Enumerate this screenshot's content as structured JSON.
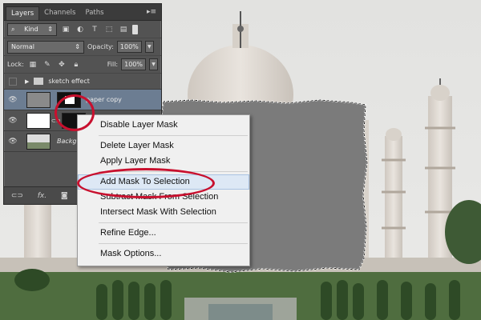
{
  "layers_panel": {
    "tabs": [
      "Layers",
      "Channels",
      "Paths"
    ],
    "filter_kind": "Kind",
    "blend_mode": "Normal",
    "opacity_label": "Opacity:",
    "opacity_value": "100%",
    "lock_label": "Lock:",
    "fill_label": "Fill:",
    "fill_value": "100%",
    "layers": [
      {
        "name": "sketch effect"
      },
      {
        "name": "paper copy"
      },
      {
        "name": ""
      },
      {
        "name": "Backg"
      }
    ],
    "footer_fx": "fx."
  },
  "context_menu": {
    "items": [
      "Disable Layer Mask",
      "Delete Layer Mask",
      "Apply Layer Mask",
      "Add Mask To Selection",
      "Subtract Mask From Selection",
      "Intersect Mask With Selection",
      "Refine Edge...",
      "Mask Options..."
    ],
    "highlighted_index": 3
  },
  "colors": {
    "panel": "#535353",
    "mask_gray": "#7b7b7b",
    "annotation_red": "#c8102e"
  }
}
